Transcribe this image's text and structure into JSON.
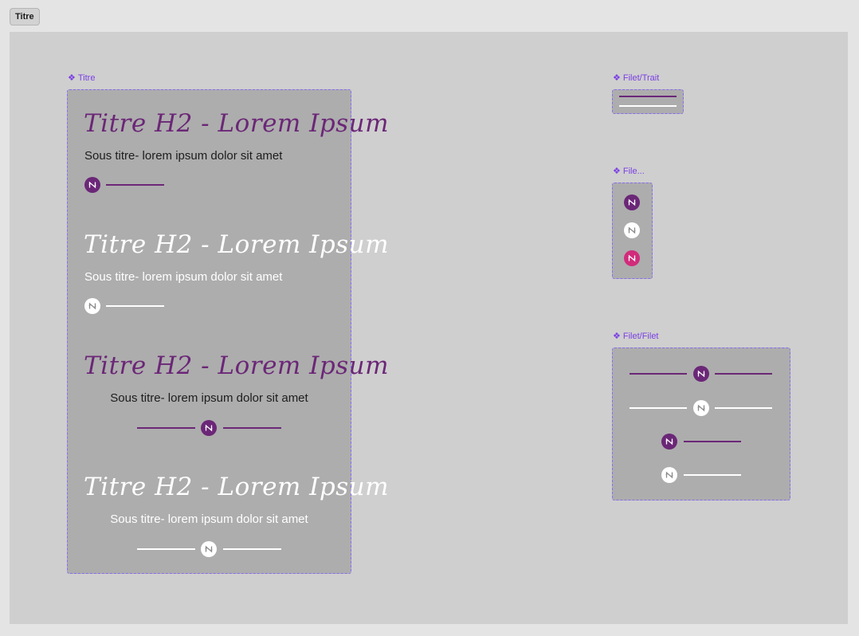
{
  "page_tab": {
    "label": "Titre"
  },
  "components": {
    "titre": {
      "label": "Titre",
      "variants": [
        {
          "title": "Titre H2 - Lorem Ipsum",
          "subtitle": "Sous titre- lorem ipsum dolor sit amet"
        },
        {
          "title": "Titre H2 - Lorem Ipsum",
          "subtitle": "Sous titre- lorem ipsum dolor sit amet"
        },
        {
          "title": "Titre H2 - Lorem Ipsum",
          "subtitle": "Sous titre- lorem ipsum dolor sit amet"
        },
        {
          "title": "Titre H2 - Lorem Ipsum",
          "subtitle": "Sous titre- lorem ipsum dolor sit amet"
        }
      ]
    },
    "filet_trait": {
      "label": "Filet/Trait"
    },
    "file": {
      "label": "File..."
    },
    "filet_filet": {
      "label": "Filet/Filet"
    }
  },
  "colors": {
    "brand_purple": "#6b2777",
    "brand_magenta": "#d12b7c",
    "white": "#ffffff",
    "component_outline": "#8a6cf0",
    "component_label": "#7b3fe4"
  },
  "icons": {
    "logo": "n-monogram-icon",
    "component": "component-diamond-icon"
  }
}
